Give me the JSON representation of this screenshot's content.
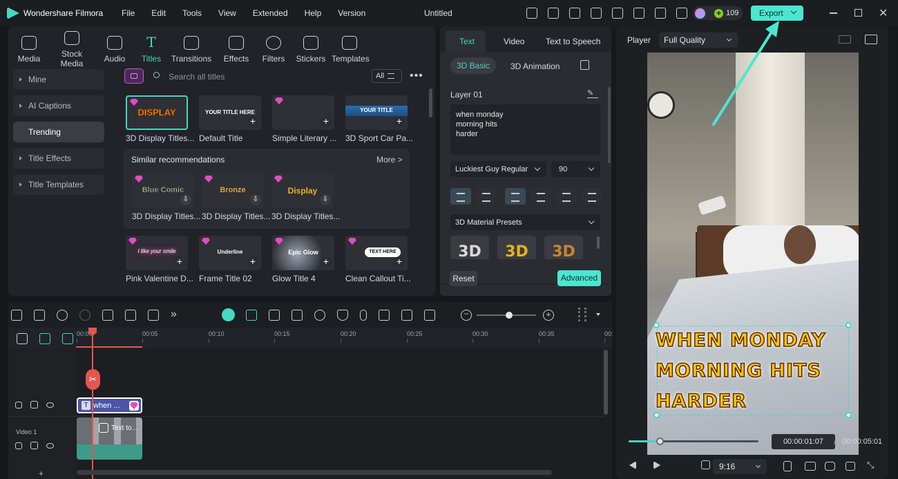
{
  "app": {
    "name": "Wondershare Filmora",
    "project_title": "Untitled"
  },
  "menu": [
    "File",
    "Edit",
    "Tools",
    "View",
    "Extended",
    "Help",
    "Version"
  ],
  "credits": "109",
  "export_label": "Export",
  "media_tabs": [
    {
      "label": "Media",
      "icon": "media-icon"
    },
    {
      "label": "Stock Media",
      "icon": "stock-media-icon"
    },
    {
      "label": "Audio",
      "icon": "audio-icon"
    },
    {
      "label": "Titles",
      "icon": "titles-icon"
    },
    {
      "label": "Transitions",
      "icon": "transitions-icon"
    },
    {
      "label": "Effects",
      "icon": "effects-icon"
    },
    {
      "label": "Filters",
      "icon": "filters-icon"
    },
    {
      "label": "Stickers",
      "icon": "stickers-icon"
    },
    {
      "label": "Templates",
      "icon": "templates-icon"
    }
  ],
  "sidebar": [
    "Mine",
    "AI Captions",
    "Trending",
    "Title Effects",
    "Title Templates"
  ],
  "search_placeholder": "Search all titles",
  "filter_label": "All",
  "titles_row1": [
    "3D Display Titles...",
    "Default Title",
    "Simple Literary ...",
    "3D Sport Car Pa..."
  ],
  "thumb_texts": {
    "display": "DISPLAY",
    "default": "YOUR TITLE HERE",
    "sport": "YOUR TITLE",
    "blue_comic": "Blue Comic",
    "bronze": "Bronze",
    "display2": "Display",
    "pink": "I like your smile",
    "underline": "Underline",
    "epic": "Epic Glow",
    "callout": "TEXT HERE"
  },
  "similar": {
    "heading": "Similar recommendations",
    "more": "More >",
    "items": [
      "3D Display Titles...",
      "3D Display Titles...",
      "3D Display Titles..."
    ]
  },
  "titles_row3": [
    "Pink Valentine D...",
    "Frame Title 02",
    "Glow Title 4",
    "Clean Callout Ti..."
  ],
  "props": {
    "tabs": [
      "Text",
      "Video",
      "Text to Speech"
    ],
    "subtabs": [
      "3D Basic",
      "3D Animation"
    ],
    "layer": "Layer 01",
    "text_lines": [
      "when monday",
      "morning hits",
      "harder"
    ],
    "font": "Luckiest Guy Regular",
    "size": "90",
    "preset_label": "3D Material Presets",
    "preset_thumb": "3D",
    "reset": "Reset",
    "advanced": "Advanced"
  },
  "timeline": {
    "ticks": [
      "00:00",
      "00:05",
      "00:10",
      "00:15",
      "00:20",
      "00:25",
      "00:30",
      "00:35",
      "00:"
    ],
    "title_clip": "when ...",
    "video_clip": "Text to...",
    "track_label": "Video 1",
    "playhead_fraction": 0.03,
    "zoom_fraction": 0.55
  },
  "player": {
    "label": "Player",
    "quality": "Full Quality",
    "overlay_lines": [
      "WHEN MONDAY",
      "MORNING HITS",
      "HARDER"
    ],
    "current_time": "00:00:01:07",
    "separator": "/",
    "total_time": "00:00:05:01",
    "aspect": "9:16",
    "progress_fraction": 0.24
  },
  "colors": {
    "accent": "#46d7c3",
    "export_bg": "#4ce6d0",
    "gem": "#e34ac6",
    "title_clip": "#4a55a8",
    "video_clip": "#3e9b8a",
    "playhead": "#e4574d"
  }
}
